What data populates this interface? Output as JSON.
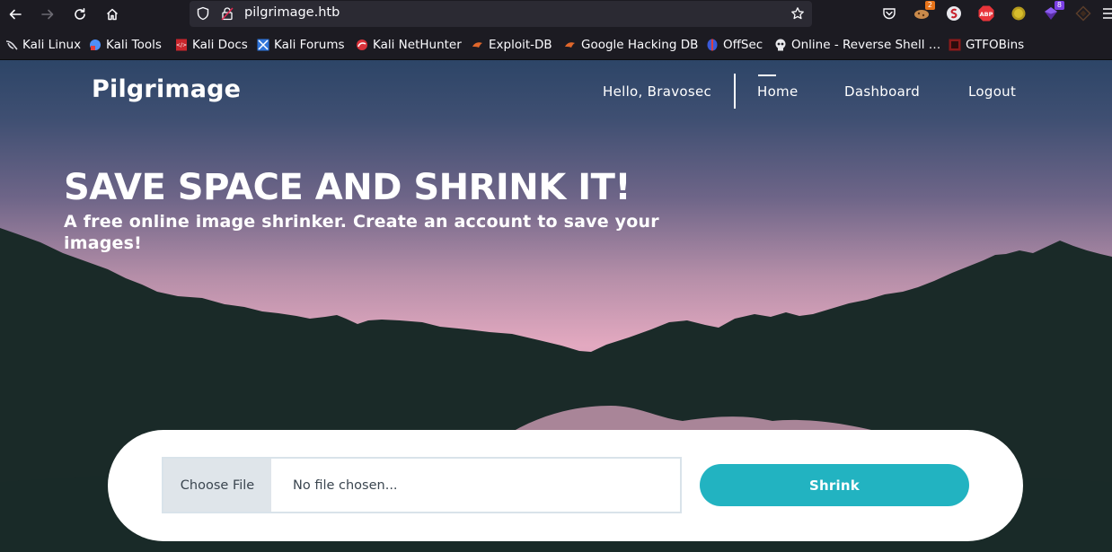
{
  "browser": {
    "url": "pilgrimage.htb",
    "extensions": [
      {
        "name": "pocket-icon"
      },
      {
        "name": "cookie-editor-icon",
        "badge": "2",
        "badge_color": "#e8741a"
      },
      {
        "name": "foxyproxy-icon"
      },
      {
        "name": "adblock-plus-icon",
        "label": "ABP"
      },
      {
        "name": "extension-yellow-icon"
      },
      {
        "name": "wappalyzer-icon",
        "badge": "8",
        "badge_color": "#7b3fe4"
      },
      {
        "name": "hackbar-icon"
      }
    ]
  },
  "bookmarks": [
    {
      "label": "Kali Linux",
      "icon": "kali-dragon-icon"
    },
    {
      "label": "Kali Tools",
      "icon": "kali-tools-icon"
    },
    {
      "label": "Kali Docs",
      "icon": "kali-docs-icon"
    },
    {
      "label": "Kali Forums",
      "icon": "kali-forums-icon"
    },
    {
      "label": "Kali NetHunter",
      "icon": "nethunter-icon"
    },
    {
      "label": "Exploit-DB",
      "icon": "exploit-db-icon"
    },
    {
      "label": "Google Hacking DB",
      "icon": "ghdb-icon"
    },
    {
      "label": "OffSec",
      "icon": "offsec-icon"
    },
    {
      "label": "Online - Reverse Shell …",
      "icon": "skull-icon"
    },
    {
      "label": "GTFOBins",
      "icon": "gtfobins-icon"
    }
  ],
  "page": {
    "brand": "Pilgrimage",
    "nav": {
      "greeting": "Hello, Bravosec",
      "home": "Home",
      "dashboard": "Dashboard",
      "logout": "Logout"
    },
    "hero": {
      "title": "SAVE SPACE AND SHRINK IT!",
      "subtitle": "A free online image shrinker. Create an account to save your images!"
    },
    "upload": {
      "choose_file": "Choose File",
      "file_status": "No file chosen...",
      "submit": "Shrink"
    }
  },
  "colors": {
    "accent": "#22b3c1",
    "mountain": "#1a2a28",
    "sky_top": "#2d4567",
    "sky_glow": "#e3a9c0"
  }
}
